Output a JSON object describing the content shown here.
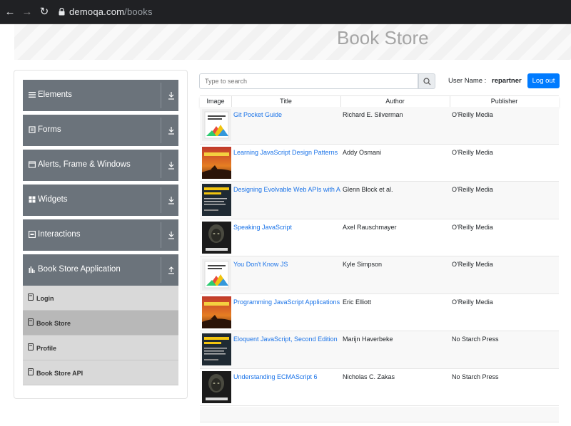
{
  "browser": {
    "url_host": "demoqa.com",
    "url_path": "/books"
  },
  "header": {
    "title": "Book Store"
  },
  "sidebar": {
    "groups": [
      {
        "label": "Elements",
        "icon": "hamburger-icon"
      },
      {
        "label": "Forms",
        "icon": "form-icon"
      },
      {
        "label": "Alerts, Frame & Windows",
        "icon": "window-icon"
      },
      {
        "label": "Widgets",
        "icon": "grid-icon"
      },
      {
        "label": "Interactions",
        "icon": "interaction-icon"
      },
      {
        "label": "Book Store Application",
        "icon": "bar-chart-icon"
      }
    ],
    "subitems": [
      {
        "label": "Login"
      },
      {
        "label": "Book Store",
        "active": true
      },
      {
        "label": "Profile"
      },
      {
        "label": "Book Store API"
      }
    ]
  },
  "search": {
    "placeholder": "Type to search"
  },
  "user": {
    "label": "User Name :",
    "value": "repartner",
    "logout_label": "Log out"
  },
  "table": {
    "columns": [
      "Image",
      "Title",
      "Author",
      "Publisher"
    ],
    "rows": [
      {
        "cover": "white",
        "title": "Git Pocket Guide",
        "author": "Richard E. Silverman",
        "publisher": "O'Reilly Media"
      },
      {
        "cover": "sunset",
        "title": "Learning JavaScript Design Patterns",
        "author": "Addy Osmani",
        "publisher": "O'Reilly Media"
      },
      {
        "cover": "dark-yellow",
        "title": "Designing Evolvable Web APIs with ASP.NET",
        "author": "Glenn Block et al.",
        "publisher": "O'Reilly Media"
      },
      {
        "cover": "header",
        "title": "Speaking JavaScript",
        "author": "Axel Rauschmayer",
        "publisher": "O'Reilly Media"
      },
      {
        "cover": "white",
        "title": "You Don't Know JS",
        "author": "Kyle Simpson",
        "publisher": "O'Reilly Media"
      },
      {
        "cover": "sunset",
        "title": "Programming JavaScript Applications",
        "author": "Eric Elliott",
        "publisher": "O'Reilly Media"
      },
      {
        "cover": "dark-yellow",
        "title": "Eloquent JavaScript, Second Edition",
        "author": "Marijn Haverbeke",
        "publisher": "No Starch Press"
      },
      {
        "cover": "header",
        "title": "Understanding ECMAScript 6",
        "author": "Nicholas C. Zakas",
        "publisher": "No Starch Press"
      }
    ]
  },
  "colors": {
    "link": "#1a73e8",
    "primary_button": "#007bff",
    "sidebar_group": "#6b737b",
    "sidebar_sub": "#d9d9d9",
    "sidebar_sub_active": "#b8b8b8"
  }
}
